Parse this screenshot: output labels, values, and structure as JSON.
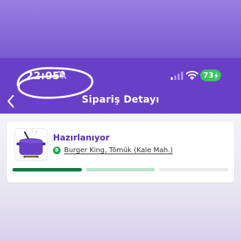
{
  "status_bar": {
    "time": "22:05",
    "battery_level": "73",
    "battery_color": "#34c759"
  },
  "header": {
    "title": "Sipariş Detayı",
    "background": "#6a3fc8"
  },
  "order": {
    "status": "Hazırlanıyor",
    "restaurant_logo_letter": "B",
    "restaurant_name": "Burger King, Tömük (Kale Mah.)"
  },
  "progress": {
    "steps": [
      {
        "state": "done",
        "color": "#0f7a43"
      },
      {
        "state": "in-progress",
        "color": "#bde2c9"
      },
      {
        "state": "pending",
        "color": "#ececee"
      }
    ]
  },
  "icons": {
    "back": "chevron-left-icon",
    "silent_mode": "bell-muted-icon",
    "signal": "cellular-signal-icon",
    "wifi": "wifi-icon",
    "battery": "battery-bolt-icon",
    "order_status": "cooking-pot-icon",
    "restaurant": "restaurant-logo-icon"
  }
}
